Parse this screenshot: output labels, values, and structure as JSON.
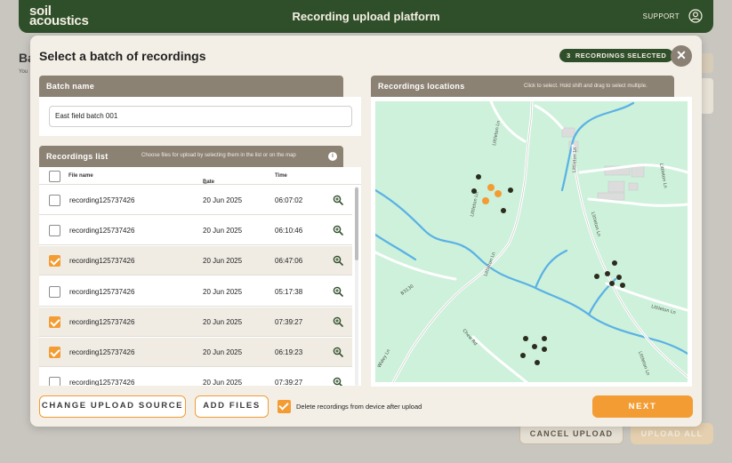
{
  "header": {
    "logo_line1": "soil",
    "logo_line2": "acoustics",
    "title": "Recording upload platform",
    "support": "SUPPORT",
    "user_icon": "user-circle-icon"
  },
  "background": {
    "heading": "Ba",
    "sub": "You",
    "cancel_upload": "CANCEL UPLOAD",
    "upload_all": "UPLOAD ALL"
  },
  "modal": {
    "title": "Select a batch of recordings",
    "selected_count": "3",
    "selected_badge": "RECORDINGS SELECTED",
    "close_icon": "close-icon",
    "batch": {
      "header": "Batch name",
      "value": "East field batch 001"
    },
    "list": {
      "header": "Recordings list",
      "hint": "Choose files for upload by selecting them in the list or on the map",
      "columns": {
        "file": "File name",
        "date": "Date",
        "time": "Time"
      },
      "rows": [
        {
          "file": "recording125737426",
          "date": "20 Jun 2025",
          "time": "06:07:02",
          "selected": false
        },
        {
          "file": "recording125737426",
          "date": "20 Jun 2025",
          "time": "06:10:46",
          "selected": false
        },
        {
          "file": "recording125737426",
          "date": "20 Jun 2025",
          "time": "06:47:06",
          "selected": true
        },
        {
          "file": "recording125737426",
          "date": "20 Jun 2025",
          "time": "05:17:38",
          "selected": false
        },
        {
          "file": "recording125737426",
          "date": "20 Jun 2025",
          "time": "07:39:27",
          "selected": true
        },
        {
          "file": "recording125737426",
          "date": "20 Jun 2025",
          "time": "06:19:23",
          "selected": true
        },
        {
          "file": "recording125737426",
          "date": "20 Jun 2025",
          "time": "07:39:27",
          "selected": false
        }
      ]
    },
    "map": {
      "header": "Recordings locations",
      "hint": "Click to select. Hold shift and drag to select multiple.",
      "road_labels": [
        "Littleton Ln",
        "Littleton Ln",
        "Littleton Ln",
        "Littleton Ln",
        "Littleton Ln",
        "Littleton Ln",
        "Littleton Ln",
        "B3130",
        "Widey Ln",
        "Chew Rd"
      ]
    },
    "footer": {
      "change_source": "CHANGE UPLOAD SOURCE",
      "add_files": "ADD FILES",
      "delete_label": "Delete recordings from device after upload",
      "delete_checked": true,
      "next": "NEXT"
    }
  },
  "colors": {
    "brand_green": "#2f4f2a",
    "accent_orange": "#f39c33",
    "panel_header": "#8c8274",
    "map_land": "#c9f0d8",
    "map_water": "#5ab1e6"
  }
}
